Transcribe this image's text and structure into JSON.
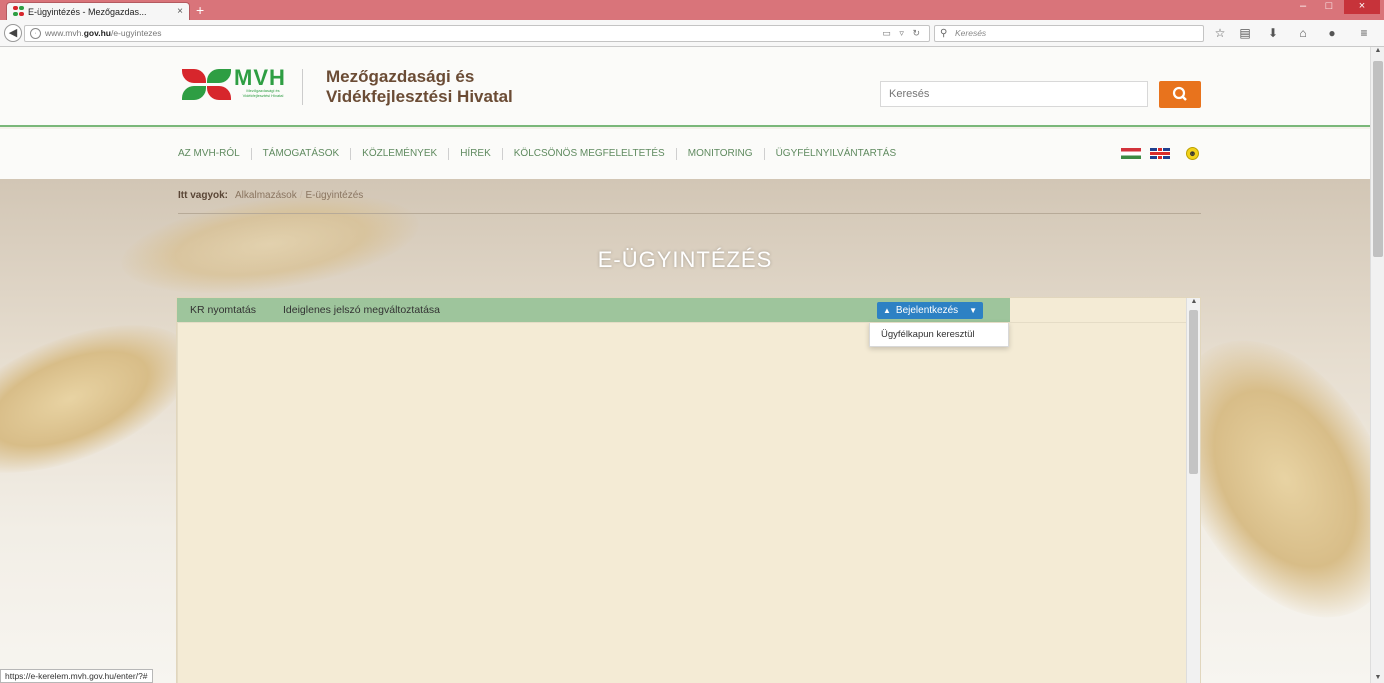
{
  "browser": {
    "tab_title": "E-ügyintézés - Mezőgazdas...",
    "tab_close": "×",
    "new_tab": "+",
    "url_prefix": "www.mvh.",
    "url_domain": "gov.hu",
    "url_path": "/e-ugyintezes",
    "search_placeholder": "Keresés",
    "status_url": "https://e-kerelem.mvh.gov.hu/enter/?#",
    "window_controls": [
      "–",
      "□",
      "×"
    ]
  },
  "site": {
    "logo_text": "MVH",
    "logo_subtitle": "Mezőgazdasági és Vidékfejlesztési Hivatal",
    "org_name_line1": "Mezőgazdasági és",
    "org_name_line2": "Vidékfejlesztési Hivatal",
    "search_placeholder": "Keresés",
    "nav_items": [
      "AZ MVH-RÓL",
      "TÁMOGATÁSOK",
      "KÖZLEMÉNYEK",
      "HÍREK",
      "KÖLCSÖNÖS MEGFELELTETÉS",
      "MONITORING",
      "ÜGYFÉLNYILVÁNTARTÁS"
    ],
    "accent_color": "#e8731d",
    "brand_green": "#2e9e43"
  },
  "breadcrumb": {
    "label": "Itt vagyok:",
    "items": [
      "Alkalmazások",
      "E-ügyintézés"
    ]
  },
  "page_title": "E-ÜGYINTÉZÉS",
  "app": {
    "toolbar_links": [
      "KR nyomtatás",
      "Ideiglenes jelszó megváltoztatása"
    ],
    "login_button": "Bejelentkezés",
    "dropdown_items": [
      "Ügyfélkapun keresztül"
    ],
    "login_color": "#2d81c4",
    "toolbar_color": "#9ec59c"
  }
}
